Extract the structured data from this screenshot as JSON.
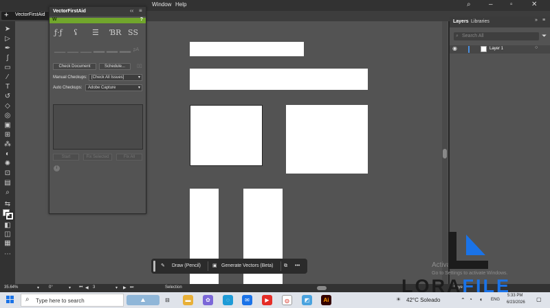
{
  "menubar": {
    "items": [
      "Window",
      "Help"
    ]
  },
  "document_tab": {
    "name": "VectorFirstAid"
  },
  "vfa_panel": {
    "title": "VectorFirstAid",
    "help_label": "?",
    "check_document_label": "Check Document",
    "schedule_label": "Schedule...",
    "manual_checkups_label": "Manual Checkups:",
    "manual_checkups_value": "[Check All Issues]",
    "auto_checkups_label": "Auto Checkups:",
    "auto_checkups_value": "Adobe Capture",
    "start_label": "Start",
    "fix_selected_label": "Fix Selected",
    "fix_all_label": "Fix All",
    "info_label": "i"
  },
  "layers_panel": {
    "tabs": [
      "Layers",
      "Libraries"
    ],
    "search_placeholder": "Search All",
    "layer_name": "Layer 1"
  },
  "context_bar": {
    "draw_label": "Draw (Pencil)",
    "generate_label": "Generate Vectors (Beta)",
    "more_label": "•••"
  },
  "status_bar": {
    "zoom": "35.64%",
    "rotation": "0°",
    "artboard": "3",
    "mode": "Selection",
    "panel_label": "Laye"
  },
  "watermark": {
    "activate_title": "Activate Windows",
    "activate_sub": "Go to Settings to activate Windows.",
    "brand_left": "LORA",
    "brand_right": "FILE"
  },
  "taskbar": {
    "search_placeholder": "Type here to search",
    "weather": "42°C  Soleado",
    "language": "ENG",
    "time": "5:33 PM",
    "date": "6/23/2026",
    "ai_label": "Ai"
  },
  "colors": {
    "accent_green": "#71a62c",
    "selection_blue": "#4a8fe0"
  }
}
